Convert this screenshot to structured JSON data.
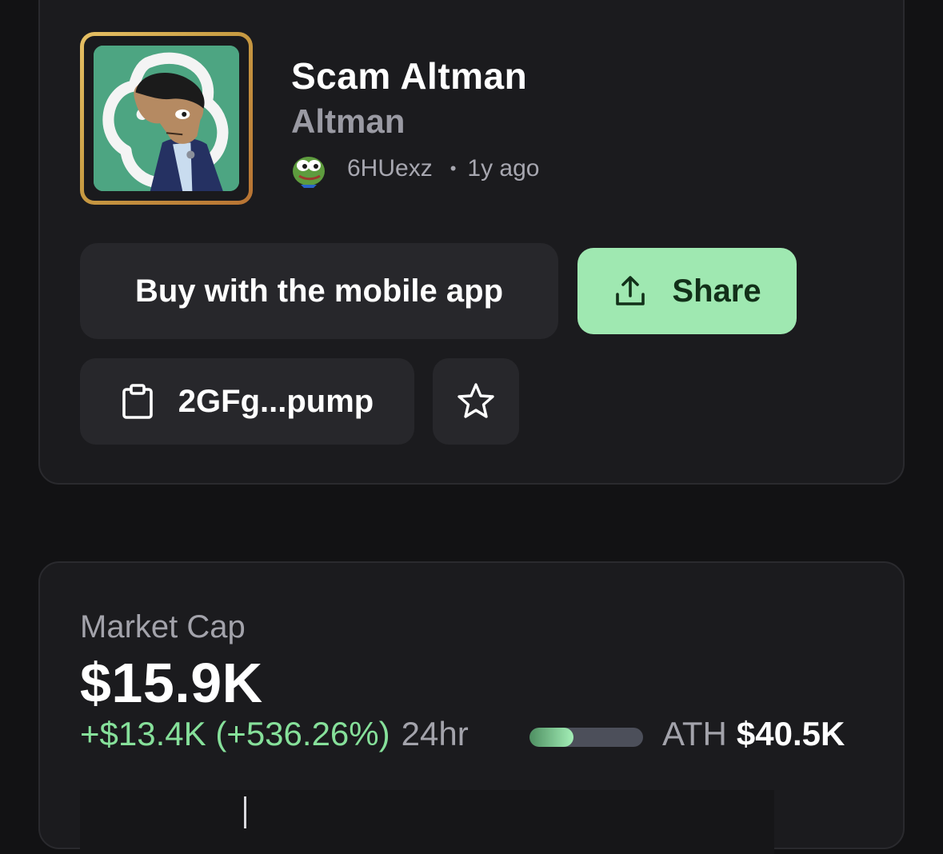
{
  "token": {
    "name": "Scam Altman",
    "ticker": "Altman",
    "creator": "6HUexz",
    "separator": "•",
    "age": "1y ago",
    "avatar_icon": "openai-logo-with-cartoon-character",
    "creator_avatar_icon": "pepe-frog-avatar"
  },
  "actions": {
    "buy_label": "Buy with the mobile app",
    "share_label": "Share",
    "share_icon": "share-upload-icon",
    "address_label": "2GFg...pump",
    "address_icon": "clipboard-icon",
    "favorite_icon": "star-icon"
  },
  "stats": {
    "market_cap_label": "Market Cap",
    "market_cap_value": "$15.9K",
    "change": "+$13.4K (+536.26%)",
    "period": "24hr",
    "ath_label": "ATH",
    "ath_value": "$40.5K",
    "ath_progress": 0.39
  },
  "colors": {
    "background": "#121214",
    "card": "#1b1b1e",
    "accent_green": "#9fe8b1",
    "positive_text": "#86e09a",
    "muted_text": "#a3a3ab"
  }
}
